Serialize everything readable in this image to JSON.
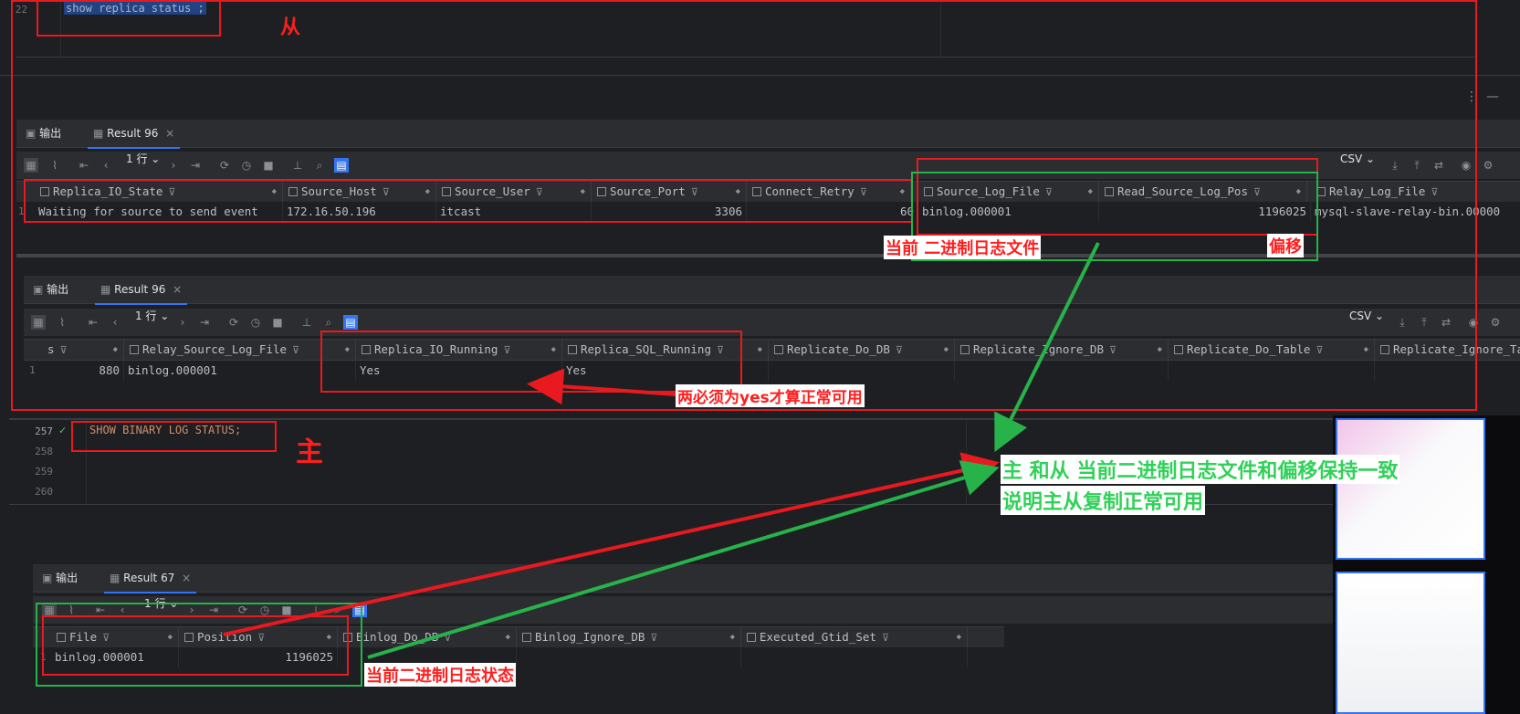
{
  "top_editor": {
    "line_number": "22",
    "code": "show replica status ;",
    "label": "从"
  },
  "replica_result_1": {
    "tabs": {
      "output": "输出",
      "result": "Result 96"
    },
    "rows_selector": "1 行",
    "export_format": "CSV",
    "columns": [
      "Replica_IO_State",
      "Source_Host",
      "Source_User",
      "Source_Port",
      "Connect_Retry",
      "Source_Log_File",
      "Read_Source_Log_Pos",
      "Relay_Log_File"
    ],
    "row_number": "1",
    "row": [
      "Waiting for source to send event",
      "172.16.50.196",
      "itcast",
      "3306",
      "60",
      "binlog.000001",
      "1196025",
      "mysql-slave-relay-bin.00000"
    ]
  },
  "replica_result_2": {
    "tabs": {
      "output": "输出",
      "result": "Result 96"
    },
    "rows_selector": "1 行",
    "export_format": "CSV",
    "first_col_fragment": "s",
    "columns": [
      "Relay_Source_Log_File",
      "Replica_IO_Running",
      "Replica_SQL_Running",
      "Replicate_Do_DB",
      "Replicate_Ignore_DB",
      "Replicate_Do_Table",
      "Replicate_Ignore_Ta"
    ],
    "row_number": "1",
    "first_cell": "880",
    "row": [
      "binlog.000001",
      "Yes",
      "Yes",
      "",
      "",
      "",
      ""
    ]
  },
  "master_editor": {
    "line_numbers": [
      "257",
      "258",
      "259",
      "260"
    ],
    "code": "SHOW BINARY LOG STATUS;",
    "label": "主"
  },
  "master_result": {
    "tabs": {
      "output": "输出",
      "result": "Result 67"
    },
    "rows_selector": "1 行",
    "columns": [
      "File",
      "Position",
      "Binlog_Do_DB",
      "Binlog_Ignore_DB",
      "Executed_Gtid_Set"
    ],
    "row_number": "1",
    "row": [
      "binlog.000001",
      "1196025",
      "",
      "",
      ""
    ]
  },
  "annotations": {
    "current_binlog_file": "当前 二进制日志文件",
    "offset": "偏移",
    "must_be_yes": "两必须为yes才算正常可用",
    "consistent_line1": "主 和从 当前二进制日志文件和偏移保持一致",
    "consistent_line2": "说明主从复制正常可用",
    "current_binlog_status": "当前二进制日志状态"
  },
  "colors": {
    "annotation_red": "#e8191f",
    "annotation_green": "#27b34a",
    "ide_background": "#1e1f22",
    "panel_background": "#2b2d30",
    "accent": "#3574f0"
  }
}
